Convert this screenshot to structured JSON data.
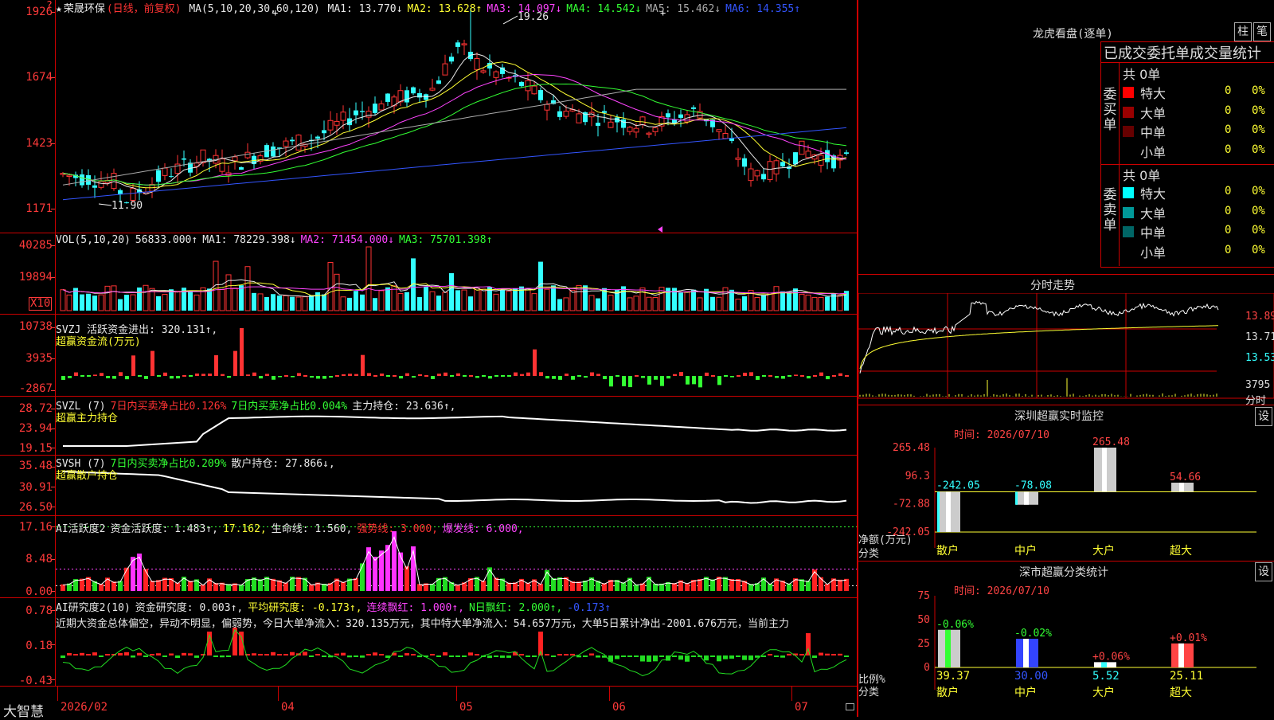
{
  "header": {
    "star": "★",
    "stock_name": "荣晟环保",
    "period_label": "(日线，前复权)",
    "ma_spec": "MA(5,10,20,30,60,120)",
    "ma": [
      {
        "label": "MA1:",
        "value": "13.770↓",
        "color": "#e8e8e8"
      },
      {
        "label": "MA2:",
        "value": "13.628↑",
        "color": "#ffff33"
      },
      {
        "label": "MA3:",
        "value": "14.097↓",
        "color": "#ff44ff"
      },
      {
        "label": "MA4:",
        "value": "14.542↓",
        "color": "#33ff33"
      },
      {
        "label": "MA5:",
        "value": "15.462↓",
        "color": "#aaaaaa"
      },
      {
        "label": "MA6:",
        "value": "14.355↑",
        "color": "#3355ff"
      }
    ],
    "high_label": "19.26",
    "low_label": "11.90",
    "mark_plus": "+",
    "mark_question": "?"
  },
  "panels": {
    "price": {
      "ticks": [
        "1926",
        "1674",
        "1423",
        "1171"
      ]
    },
    "vol": {
      "ticks": [
        "40285",
        "19894"
      ],
      "unit": "X10",
      "legend": [
        {
          "text": "VOL(5,10,20)",
          "color": "#e8e8e8"
        },
        {
          "text": "56833.000↑",
          "color": "#e8e8e8"
        },
        {
          "text": "MA1: 78229.398↓",
          "color": "#e8e8e8"
        },
        {
          "text": "MA2: 71454.000↓",
          "color": "#ff44ff"
        },
        {
          "text": "MA3: 75701.398↑",
          "color": "#33ff33"
        }
      ]
    },
    "svzj": {
      "ticks": [
        "10738",
        "3935",
        "-2867"
      ],
      "legend": "SVZJ  活跃资金进出: 320.131↑,",
      "sub": "超赢资金流(万元)"
    },
    "svzl": {
      "ticks": [
        "28.72",
        "23.94",
        "19.15"
      ],
      "legend": [
        {
          "text": "SVZL (7)",
          "color": "#e8e8e8"
        },
        {
          "text": "7日内买卖净占比0.126%",
          "color": "#ff3333"
        },
        {
          "text": "7日内买卖净占比0.004%",
          "color": "#33ff33"
        },
        {
          "text": "主力持仓: 23.636↑,",
          "color": "#e8e8e8"
        }
      ],
      "sub": "超赢主力持仓"
    },
    "svsh": {
      "ticks": [
        "35.48",
        "30.91",
        "26.50"
      ],
      "legend": [
        {
          "text": "SVSH (7)",
          "color": "#e8e8e8"
        },
        {
          "text": "7日内买卖净占比0.209%",
          "color": "#33ff33"
        },
        {
          "text": "散户持仓: 27.866↓,",
          "color": "#e8e8e8"
        }
      ],
      "sub": "超赢散户持仓"
    },
    "ai_active": {
      "ticks": [
        "17.16",
        "8.48",
        "0.00"
      ],
      "legend": [
        {
          "text": "AI活跃度2",
          "color": "#e8e8e8"
        },
        {
          "text": "资金活跃度: 1.483↑,",
          "color": "#e8e8e8"
        },
        {
          "text": "17.162,",
          "color": "#ffff33"
        },
        {
          "text": "生命线: 1.560,",
          "color": "#e8e8e8"
        },
        {
          "text": "强势线: 3.000,",
          "color": "#ff3333"
        },
        {
          "text": "爆发线: 6.000,",
          "color": "#ff44ff"
        }
      ]
    },
    "ai_research": {
      "ticks": [
        "0.78",
        "0.18",
        "-0.43"
      ],
      "legend": [
        {
          "text": "AI研究度2(10)",
          "color": "#e8e8e8"
        },
        {
          "text": "资金研究度: 0.003↑,",
          "color": "#e8e8e8"
        },
        {
          "text": "平均研究度: -0.173↑,",
          "color": "#ffff33"
        },
        {
          "text": "连续飘红: 1.000↑,",
          "color": "#ff44ff"
        },
        {
          "text": "N日飘红: 2.000↑,",
          "color": "#33ff33"
        },
        {
          "text": "-0.173↑",
          "color": "#3355ff"
        }
      ],
      "text": "近期大资金总体偏空，异动不明显，偏弱势，今日大单净流入：320.135万元，其中特大单净流入：54.657万元，大单5日累计净出-2001.676万元，当前主力"
    }
  },
  "xaxis": {
    "labels": [
      "2026/02",
      "04",
      "05",
      "06",
      "07"
    ]
  },
  "footer": {
    "brand": "大智慧"
  },
  "right": {
    "lhkp": {
      "title": "龙虎看盘(逐单)",
      "btn1": "柱",
      "btn2": "笔",
      "section_title": "已成交委托单成交量统计",
      "buy": {
        "vert": "委买单",
        "total": "共 0单",
        "rows": [
          {
            "label": "特大",
            "count": "0",
            "pct": "0%",
            "color": "#ff0000"
          },
          {
            "label": "大单",
            "count": "0",
            "pct": "0%",
            "color": "#990000"
          },
          {
            "label": "中单",
            "count": "0",
            "pct": "0%",
            "color": "#660000"
          },
          {
            "label": "小单",
            "count": "0",
            "pct": "0%",
            "color": "#000000"
          }
        ]
      },
      "sell": {
        "vert": "委卖单",
        "total": "共 0单",
        "rows": [
          {
            "label": "特大",
            "count": "0",
            "pct": "0%",
            "color": "#00ffff"
          },
          {
            "label": "大单",
            "count": "0",
            "pct": "0%",
            "color": "#009999"
          },
          {
            "label": "中单",
            "count": "0",
            "pct": "0%",
            "color": "#006666"
          },
          {
            "label": "小单",
            "count": "0",
            "pct": "0%",
            "color": "#000000"
          }
        ]
      }
    },
    "fenshi": {
      "title": "分时走势",
      "ticks": [
        "13.89",
        "13.71",
        "13.53",
        "3795",
        "分时"
      ]
    },
    "monitor": {
      "title": "深圳超赢实时监控",
      "btn": "设",
      "time": "时间: 2026/07/10",
      "ticks": [
        "265.48",
        "96.3",
        "-72.88",
        "-242.05"
      ],
      "ylabel1": "净额(万元)",
      "ylabel2": "分类",
      "categories": [
        "散户",
        "中户",
        "大户",
        "超大"
      ]
    },
    "classify": {
      "title": "深市超赢分类统计",
      "btn": "设",
      "time": "时间: 2026/07/10",
      "ticks": [
        "75",
        "50",
        "25",
        "0"
      ],
      "ylabel1": "比例%",
      "ylabel2": "分类",
      "categories": [
        "散户",
        "中户",
        "大户",
        "超大"
      ]
    }
  },
  "chart_data": [
    {
      "type": "bar",
      "title": "深圳超赢实时监控",
      "xlabel": "分类",
      "ylabel": "净额(万元)",
      "categories": [
        "散户",
        "中户",
        "大户",
        "超大"
      ],
      "values": [
        -242.05,
        -78.08,
        265.48,
        54.66
      ],
      "labels": [
        "-242.05",
        "-78.08",
        "265.48",
        "54.66"
      ],
      "ylim": [
        -242.05,
        265.48
      ]
    },
    {
      "type": "bar",
      "title": "深市超赢分类统计",
      "xlabel": "分类",
      "ylabel": "比例%",
      "categories": [
        "散户",
        "中户",
        "大户",
        "超大"
      ],
      "values": [
        39.37,
        30.0,
        5.52,
        25.11
      ],
      "pct_labels": [
        "-0.06%",
        "-0.02%",
        "+0.06%",
        "+0.01%"
      ],
      "value_labels": [
        "39.37",
        "30.00",
        "5.52",
        "25.11"
      ],
      "ylim": [
        0,
        75
      ]
    },
    {
      "type": "line",
      "title": "荣晟环保 日线",
      "ylim": [
        11.71,
        19.26
      ],
      "x": [
        "2026/02",
        "04",
        "05",
        "06",
        "07"
      ],
      "series": [
        {
          "name": "MA1",
          "values": [
            13.0,
            13.6,
            14.2,
            15.3,
            16.2,
            17.8,
            17.0,
            16.0,
            15.4,
            15.1,
            14.4,
            13.4,
            13.8
          ]
        }
      ]
    }
  ]
}
